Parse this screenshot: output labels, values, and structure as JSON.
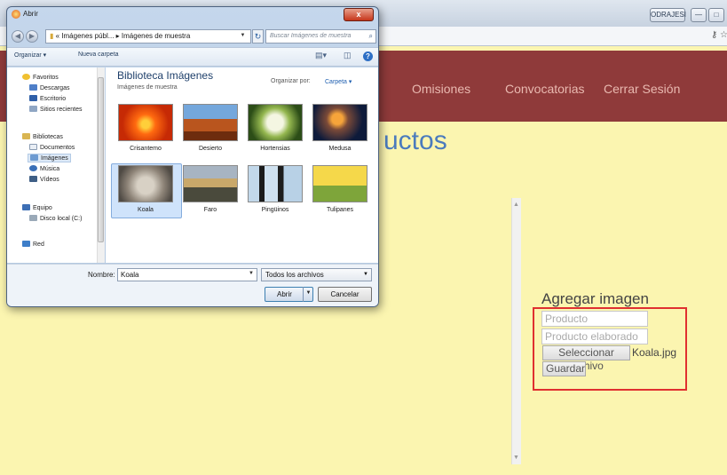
{
  "browser": {
    "user_button": "ODRAJESI",
    "win_min": "—",
    "win_max": "□"
  },
  "site_nav": [
    {
      "label": "Omisiones"
    },
    {
      "label": "Convocatorias"
    },
    {
      "label": "Cerrar Sesión"
    }
  ],
  "page": {
    "heading": "uctos",
    "add_image_title": "Agregar imagen",
    "product_placeholder": "Producto",
    "made_with_placeholder": "Producto elaborado con",
    "choose_file_button": "Seleccionar archivo",
    "chosen_file": "Koala.jpg",
    "save_button": "Guardar"
  },
  "dialog": {
    "title": "Abrir",
    "close": "x",
    "address": "« Imágenes públ... ▸ Imágenes de muestra",
    "search_placeholder": "Buscar Imágenes de muestra",
    "toolbar": {
      "organize": "Organizar ▾",
      "new_folder": "Nueva carpeta"
    },
    "nav": [
      {
        "label": "Favoritos"
      },
      {
        "label": "Descargas"
      },
      {
        "label": "Escritorio"
      },
      {
        "label": "Sitios recientes"
      },
      {
        "label": "Bibliotecas"
      },
      {
        "label": "Documentos"
      },
      {
        "label": "Imágenes"
      },
      {
        "label": "Música"
      },
      {
        "label": "Vídeos"
      },
      {
        "label": "Equipo"
      },
      {
        "label": "Disco local (C:)"
      },
      {
        "label": "Red"
      }
    ],
    "library_title": "Biblioteca Imágenes",
    "library_subtitle": "Imágenes de muestra",
    "arrange_label": "Organizar por:",
    "arrange_value": "Carpeta ▾",
    "files": [
      {
        "label": "Crisantemo"
      },
      {
        "label": "Desierto"
      },
      {
        "label": "Hortensias"
      },
      {
        "label": "Medusa"
      },
      {
        "label": "Koala"
      },
      {
        "label": "Faro"
      },
      {
        "label": "Pingüinos"
      },
      {
        "label": "Tulipanes"
      }
    ],
    "filename_label": "Nombre:",
    "filename_value": "Koala",
    "filetype_value": "Todos los archivos",
    "open_button": "Abrir",
    "cancel_button": "Cancelar"
  }
}
